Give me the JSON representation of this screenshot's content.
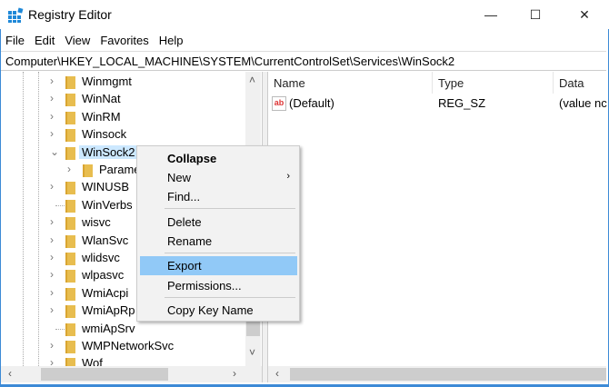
{
  "window": {
    "title": "Registry Editor",
    "minimize": "—",
    "maximize": "☐",
    "close": "✕"
  },
  "menubar": [
    "File",
    "Edit",
    "View",
    "Favorites",
    "Help"
  ],
  "address": "Computer\\HKEY_LOCAL_MACHINE\\SYSTEM\\CurrentControlSet\\Services\\WinSock2",
  "tree": [
    {
      "label": "Winmgmt",
      "chev": "›"
    },
    {
      "label": "WinNat",
      "chev": "›"
    },
    {
      "label": "WinRM",
      "chev": "›"
    },
    {
      "label": "Winsock",
      "chev": "›"
    },
    {
      "label": "WinSock2",
      "chev": "⌄",
      "selected": true
    },
    {
      "label": "Parame",
      "chev": "›",
      "child": true
    },
    {
      "label": "WINUSB",
      "chev": "›"
    },
    {
      "label": "WinVerbs",
      "chev": ""
    },
    {
      "label": "wisvc",
      "chev": "›"
    },
    {
      "label": "WlanSvc",
      "chev": "›"
    },
    {
      "label": "wlidsvc",
      "chev": "›"
    },
    {
      "label": "wlpasvc",
      "chev": "›"
    },
    {
      "label": "WmiAcpi",
      "chev": "›"
    },
    {
      "label": "WmiApRp",
      "chev": "›"
    },
    {
      "label": "wmiApSrv",
      "chev": ""
    },
    {
      "label": "WMPNetworkSvc",
      "chev": "›"
    },
    {
      "label": "Wof",
      "chev": "›"
    }
  ],
  "list": {
    "columns": [
      "Name",
      "Type",
      "Data"
    ],
    "rows": [
      {
        "name": "(Default)",
        "type": "REG_SZ",
        "data": "(value nc",
        "icon": "ab"
      }
    ]
  },
  "context_menu": {
    "items": [
      "Collapse",
      "New",
      "Find...",
      "Delete",
      "Rename",
      "Export",
      "Permissions...",
      "Copy Key Name"
    ],
    "highlighted": "Export",
    "submenu_arrow": "›"
  },
  "scroll": {
    "left": "‹",
    "right": "›",
    "up": "˄",
    "down": "˅"
  }
}
